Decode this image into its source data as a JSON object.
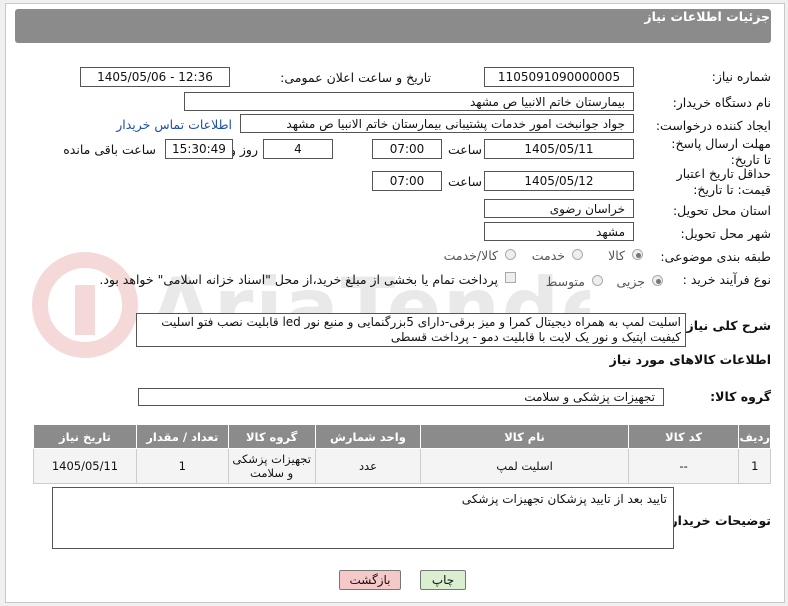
{
  "header": {
    "title": "جزئیات اطلاعات نیاز"
  },
  "fields": {
    "need_number_label": "شماره نیاز:",
    "need_number": "1105091090000005",
    "announce_label": "تاریخ و ساعت اعلان عمومی:",
    "announce_value": "1405/05/06 - 12:36",
    "buyer_org_label": "نام دستگاه خریدار:",
    "buyer_org": "بیمارستان خاتم الانبیا  ص  مشهد",
    "requester_label": "ایجاد کننده درخواست:",
    "requester": "جواد جوانبخت امور خدمات پشتیبانی بیمارستان خاتم الانبیا  ص  مشهد",
    "contact_link": "اطلاعات تماس خریدار",
    "reply_deadline_label": "مهلت ارسال پاسخ: تا تاریخ:",
    "reply_date": "1405/05/11",
    "time_label": "ساعت",
    "reply_time": "07:00",
    "days_value": "4",
    "days_label": "روز و",
    "remaining_time": "15:30:49",
    "remaining_label": "ساعت باقی مانده",
    "price_validity_label": "حداقل تاریخ اعتبار قیمت: تا تاریخ:",
    "price_date": "1405/05/12",
    "price_time_label": "ساعت",
    "price_time": "07:00",
    "province_label": "استان محل تحویل:",
    "province": "خراسان رضوی",
    "city_label": "شهر محل تحویل:",
    "city": "مشهد",
    "category_label": "طبقه بندی موضوعی:",
    "category_options": [
      "کالا",
      "خدمت",
      "کالا/خدمت"
    ],
    "purchase_type_label": "نوع فرآیند خرید :",
    "purchase_options": [
      "جزیی",
      "متوسط"
    ],
    "payment_note": "پرداخت تمام یا بخشی از مبلغ خرید،از محل \"اسناد خزانه اسلامی\" خواهد بود."
  },
  "description": {
    "label": "شرح کلی نیاز:",
    "text": "اسلیت لمپ به همراه دیجیتال کمرا و میز برقی-دارای 5بزرگنمایی و منبع نور led قابلیت نصب فتو اسلیت کیفیت اپتیک و نور یک لایت  با قابلیت دمو - پرداخت قسطی"
  },
  "goods": {
    "section_title": "اطلاعات کالاهای مورد نیاز",
    "group_label": "گروه کالا:",
    "group_value": "تجهیزات پزشکی و سلامت",
    "columns": [
      "ردیف",
      "کد کالا",
      "نام کالا",
      "واحد شمارش",
      "گروه کالا",
      "تعداد / مقدار",
      "تاریخ نیاز"
    ],
    "rows": [
      [
        "1",
        "--",
        "اسلیت لمپ",
        "عدد",
        "تجهیزات پزشکی و سلامت",
        "1",
        "1405/05/11"
      ]
    ]
  },
  "buyer_notes": {
    "label": "توضیحات خریدار:",
    "text": "تایید بعد از تایید پزشکان تجهیزات پزشکی"
  },
  "buttons": {
    "print": "چاپ",
    "back": "بازگشت"
  },
  "colors": {
    "header_bg": "#8b8b8b",
    "link": "#1f4fa8",
    "back_button": "#f6c9c9",
    "print_button": "#d9efd0"
  }
}
